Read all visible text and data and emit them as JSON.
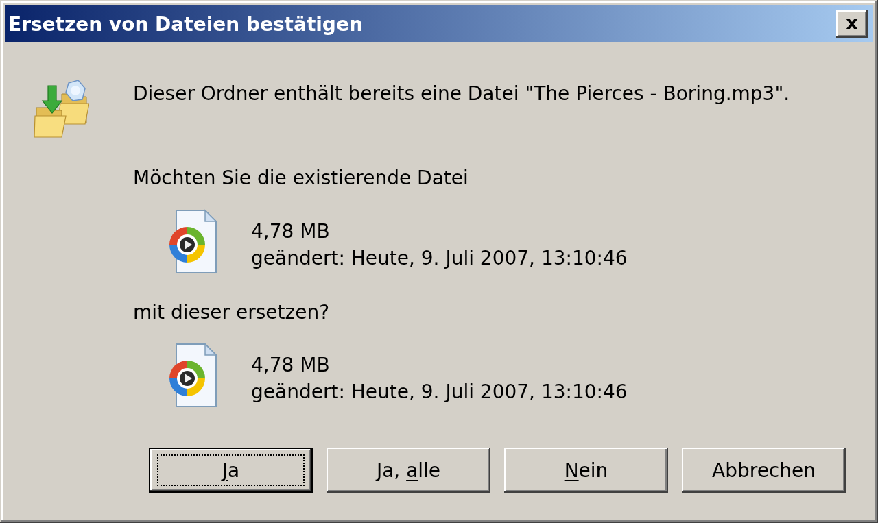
{
  "window": {
    "title": "Ersetzen von Dateien bestätigen"
  },
  "message": "Dieser Ordner enthält bereits eine Datei \"The Pierces - Boring.mp3\".",
  "question_start": "Möchten Sie die existierende Datei",
  "existing_file": {
    "size": "4,78 MB",
    "modified": "geändert: Heute, 9. Juli 2007, 13:10:46"
  },
  "question_end": "mit dieser ersetzen?",
  "new_file": {
    "size": "4,78 MB",
    "modified": "geändert: Heute, 9. Juli 2007, 13:10:46"
  },
  "buttons": [
    {
      "label": [
        {
          "text": "J",
          "underline": true
        },
        {
          "text": "a",
          "underline": false
        }
      ],
      "default": true,
      "focused": true
    },
    {
      "label": [
        {
          "text": "Ja, ",
          "underline": false
        },
        {
          "text": "a",
          "underline": true
        },
        {
          "text": "lle",
          "underline": false
        }
      ],
      "default": false,
      "focused": false
    },
    {
      "label": [
        {
          "text": "N",
          "underline": true
        },
        {
          "text": "ein",
          "underline": false
        }
      ],
      "default": false,
      "focused": false
    },
    {
      "label": [
        {
          "text": "Abbrechen",
          "underline": false
        }
      ],
      "default": false,
      "focused": false
    }
  ]
}
